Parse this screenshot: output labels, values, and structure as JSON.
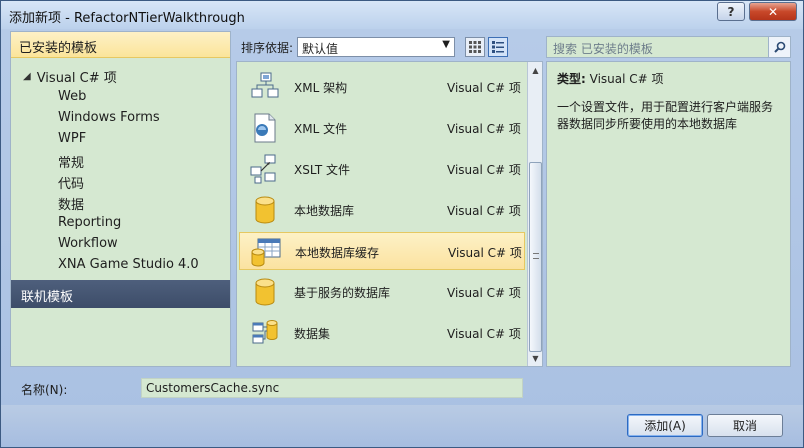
{
  "window": {
    "title": "添加新项 - RefactorNTierWalkthrough",
    "help_label": "?",
    "close_label": "✕"
  },
  "left_panel": {
    "header": "已安装的模板",
    "root": "Visual C# 项",
    "items": [
      {
        "label": "Web"
      },
      {
        "label": "Windows Forms"
      },
      {
        "label": "WPF"
      },
      {
        "label": "常规"
      },
      {
        "label": "代码"
      },
      {
        "label": "数据"
      },
      {
        "label": "Reporting"
      },
      {
        "label": "Workflow"
      },
      {
        "label": "XNA Game Studio 4.0"
      }
    ],
    "online_header": "联机模板"
  },
  "toolbar": {
    "sort_label": "排序依据:",
    "sort_value": "默认值",
    "search_placeholder": "搜索 已安装的模板"
  },
  "templates": [
    {
      "name": "XML 架构",
      "lang": "Visual C# 项",
      "icon": "xml-schema-icon"
    },
    {
      "name": "XML 文件",
      "lang": "Visual C# 项",
      "icon": "xml-file-icon"
    },
    {
      "name": "XSLT 文件",
      "lang": "Visual C# 项",
      "icon": "xslt-file-icon"
    },
    {
      "name": "本地数据库",
      "lang": "Visual C# 项",
      "icon": "database-icon"
    },
    {
      "name": "本地数据库缓存",
      "lang": "Visual C# 项",
      "icon": "database-cache-icon",
      "selected": true
    },
    {
      "name": "基于服务的数据库",
      "lang": "Visual C# 项",
      "icon": "database-icon"
    },
    {
      "name": "数据集",
      "lang": "Visual C# 项",
      "icon": "dataset-icon"
    }
  ],
  "details": {
    "type_label": "类型:",
    "type_value": "Visual C# 项",
    "description": "一个设置文件，用于配置进行客户端服务器数据同步所要使用的本地数据库"
  },
  "name_field": {
    "label": "名称(N):",
    "value": "CustomersCache.sync"
  },
  "buttons": {
    "add": "添加(A)",
    "cancel": "取消"
  },
  "colors": {
    "panel_bg": "#d5e8d1",
    "selected_bg": "#fbe49a",
    "online_header_bg": "#44556f"
  }
}
